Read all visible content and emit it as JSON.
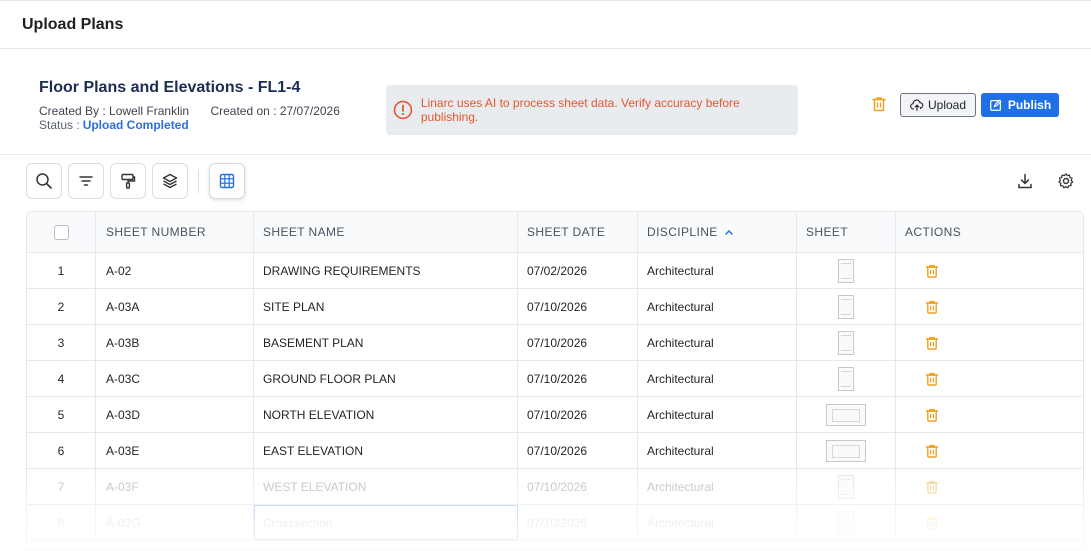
{
  "page": {
    "title": "Upload Plans"
  },
  "plan": {
    "title": "Floor Plans and Elevations - FL1-4",
    "created_by_label": "Created By :",
    "created_by": "Lowell Franklin",
    "created_on_label": "Created on :",
    "created_on": "27/07/2026",
    "status_label": "Status :",
    "status": "Upload Completed"
  },
  "banner": {
    "message": "Linarc uses AI to process sheet data. Verify accuracy before publishing."
  },
  "actions": {
    "upload_label": "Upload",
    "publish_label": "Publish"
  },
  "toolbar": {
    "tools": [
      "search-icon",
      "filter-icon",
      "paint-roller-icon",
      "layers-icon",
      "grid-icon"
    ]
  },
  "table": {
    "headers": [
      "SHEET NUMBER",
      "SHEET NAME",
      "SHEET DATE",
      "DISCIPLINE",
      "SHEET",
      "ACTIONS"
    ],
    "sort_column": "DISCIPLINE",
    "sort_direction": "ascending",
    "rows": [
      {
        "index": "1",
        "number": "A-02",
        "name": "DRAWING REQUIREMENTS",
        "date": "07/02/2026",
        "discipline": "Architectural",
        "thumb": "portrait"
      },
      {
        "index": "2",
        "number": "A-03A",
        "name": "SITE PLAN",
        "date": "07/10/2026",
        "discipline": "Architectural",
        "thumb": "portrait"
      },
      {
        "index": "3",
        "number": "A-03B",
        "name": "BASEMENT PLAN",
        "date": "07/10/2026",
        "discipline": "Architectural",
        "thumb": "portrait"
      },
      {
        "index": "4",
        "number": "A-03C",
        "name": "GROUND FLOOR PLAN",
        "date": "07/10/2026",
        "discipline": "Architectural",
        "thumb": "portrait"
      },
      {
        "index": "5",
        "number": "A-03D",
        "name": "NORTH ELEVATION",
        "date": "07/10/2026",
        "discipline": "Architectural",
        "thumb": "landscape"
      },
      {
        "index": "6",
        "number": "A-03E",
        "name": "EAST ELEVATION",
        "date": "07/10/2026",
        "discipline": "Architectural",
        "thumb": "landscape"
      },
      {
        "index": "7",
        "number": "A-03F",
        "name": "WEST ELEVATION",
        "date": "07/10/2026",
        "discipline": "Architectural",
        "thumb": "portrait"
      },
      {
        "index": "8",
        "number": "A-03G",
        "name": "Crosssection",
        "date": "07/10/2026",
        "discipline": "Architectural",
        "thumb": "portrait"
      }
    ]
  },
  "colors": {
    "accent": "#1f6fe5",
    "warning": "#e4572e",
    "trash": "#f0a11b",
    "title": "#1b2c55"
  }
}
